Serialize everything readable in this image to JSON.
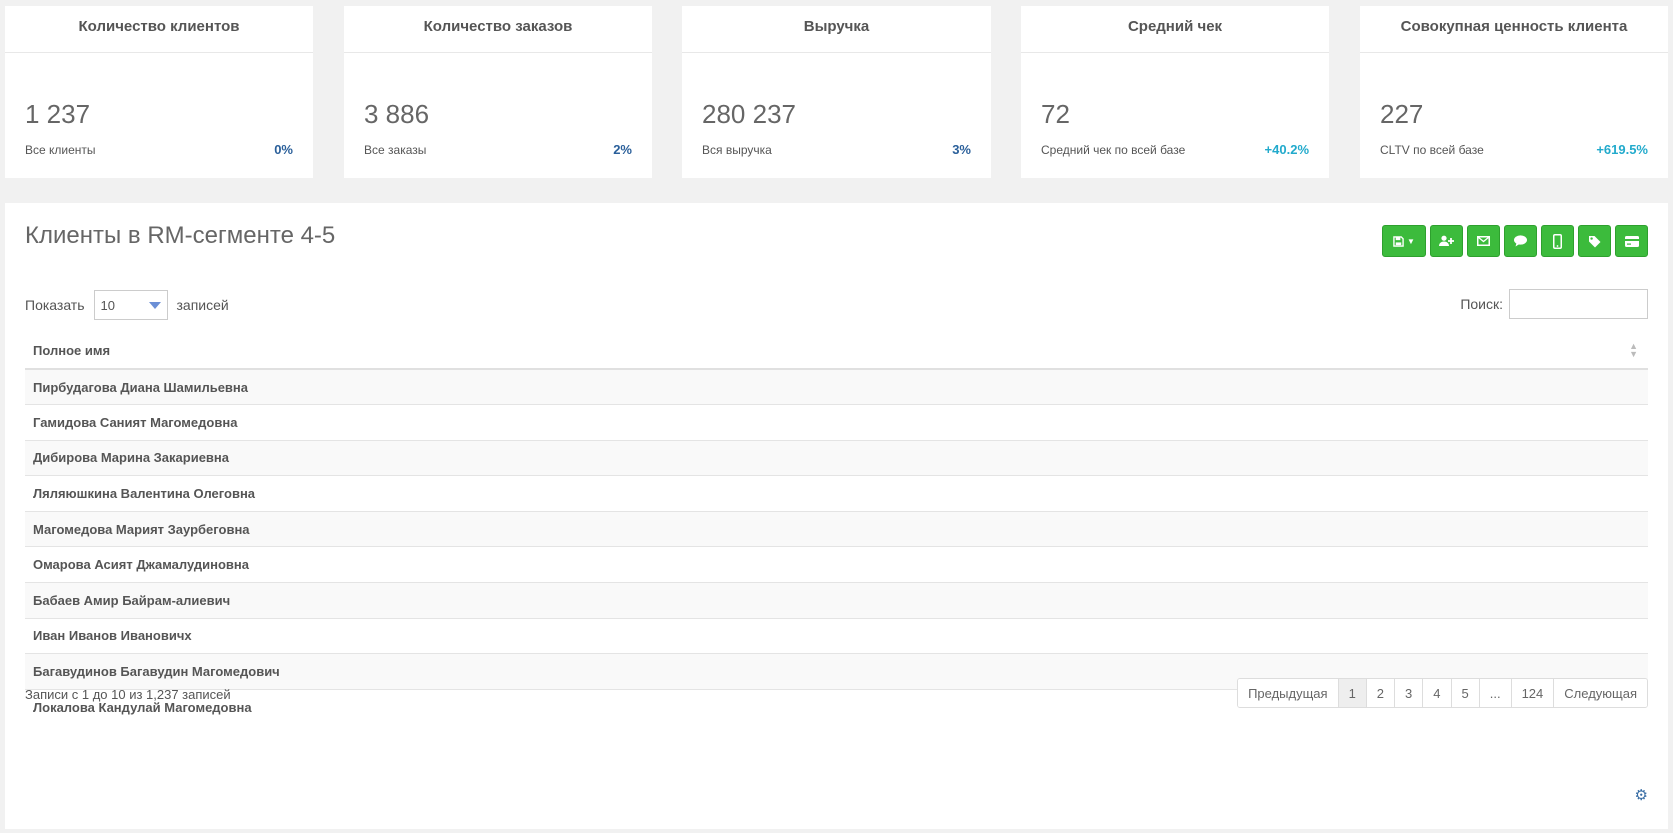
{
  "stats": [
    {
      "title": "Количество клиентов",
      "value": "1 237",
      "sub": "Все клиенты",
      "pct": "0%"
    },
    {
      "title": "Количество заказов",
      "value": "3 886",
      "sub": "Все заказы",
      "pct": "2%"
    },
    {
      "title": "Выручка",
      "value": "280 237",
      "sub": "Вся выручка",
      "pct": "3%"
    },
    {
      "title": "Средний чек",
      "value": "72",
      "sub": "Средний чек по всей базе",
      "pct": "+40.2%"
    },
    {
      "title": "Совокупная ценность клиента",
      "value": "227",
      "sub": "CLTV по всей базе",
      "pct": "+619.5%"
    }
  ],
  "panel": {
    "title": "Клиенты в RM-сегменте 4-5",
    "toolbar_icons": [
      "save-icon",
      "add-user-icon",
      "envelope-icon",
      "comment-icon",
      "mobile-icon",
      "tag-icon",
      "credit-card-icon"
    ],
    "show_label": "Показать",
    "length_value": "10",
    "entries_label": "записей",
    "search_label": "Поиск:",
    "search_value": "",
    "column_header": "Полное имя",
    "rows": [
      "Пирбудагова Диана Шамильевна",
      "Гамидова Саният Магомедовна",
      "Дибирова Марина Закариевна",
      "Ляляюшкина Валентина Олеговна",
      "Магомедова Марият Заурбеговна",
      "Омарова Асият Джамалудиновна",
      "Бабаев Амир Байрам-алиевич",
      "Иван Иванов Ивановичх",
      "Багавудинов Багавудин Магомедович",
      "Локалова Кандулай Магомедовна"
    ],
    "info": "Записи с 1 до 10 из 1,237 записей",
    "pagination": {
      "prev": "Предыдущая",
      "pages": [
        "1",
        "2",
        "3",
        "4",
        "5",
        "...",
        "124"
      ],
      "next": "Следующая",
      "active_page": "1"
    }
  },
  "colors": {
    "accent_green": "#3cbb3c",
    "pct_dark": "#2a5f9a",
    "pct_teal": "#22aacc"
  }
}
